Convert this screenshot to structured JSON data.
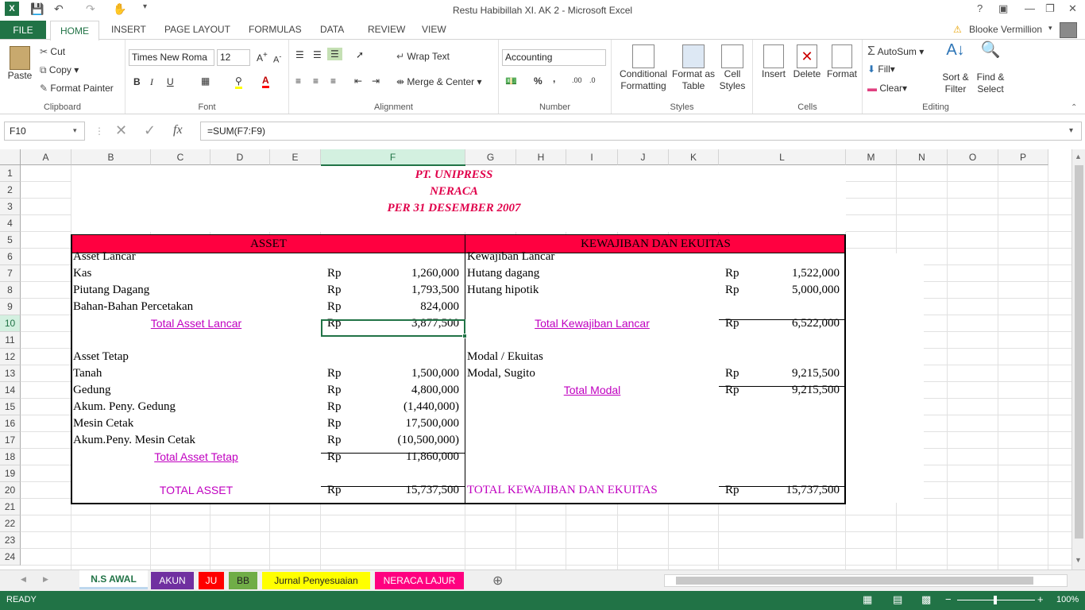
{
  "window": {
    "title": "Restu Habibillah XI. AK 2 - Microsoft Excel",
    "user": "Blooke Vermillion"
  },
  "ribbon_tabs": [
    "FILE",
    "HOME",
    "INSERT",
    "PAGE LAYOUT",
    "FORMULAS",
    "DATA",
    "REVIEW",
    "VIEW"
  ],
  "clipboard": {
    "paste": "Paste",
    "cut": "Cut",
    "copy": "Copy",
    "format_painter": "Format Painter",
    "label": "Clipboard"
  },
  "font": {
    "name": "Times New Roma",
    "size": "12",
    "bold": "B",
    "italic": "I",
    "underline": "U",
    "label": "Font"
  },
  "alignment": {
    "wrap": "Wrap Text",
    "merge": "Merge & Center",
    "label": "Alignment"
  },
  "number": {
    "format": "Accounting",
    "percent": "%",
    "comma": ",",
    "label": "Number"
  },
  "styles": {
    "conditional": [
      "Conditional",
      "Formatting"
    ],
    "format_table": [
      "Format as",
      "Table"
    ],
    "cell_styles": [
      "Cell",
      "Styles"
    ],
    "label": "Styles"
  },
  "cells": {
    "insert": "Insert",
    "delete": "Delete",
    "format": "Format",
    "label": "Cells"
  },
  "editing": {
    "autosum": "AutoSum",
    "fill": "Fill",
    "clear": "Clear",
    "sort": [
      "Sort &",
      "Filter"
    ],
    "find": [
      "Find &",
      "Select"
    ],
    "label": "Editing"
  },
  "formula_bar": {
    "name_box": "F10",
    "formula": "=SUM(F7:F9)",
    "fx": "fx"
  },
  "columns": [
    "A",
    "B",
    "C",
    "D",
    "E",
    "F",
    "G",
    "H",
    "I",
    "J",
    "K",
    "L",
    "M",
    "N",
    "O",
    "P"
  ],
  "rows": [
    "1",
    "2",
    "3",
    "4",
    "5",
    "6",
    "7",
    "8",
    "9",
    "10",
    "11",
    "12",
    "13",
    "14",
    "15",
    "16",
    "17",
    "18",
    "19",
    "20",
    "21",
    "22",
    "23",
    "24"
  ],
  "sheet": {
    "title1": "PT. UNIPRESS",
    "title2": "NERACA",
    "title3": "PER 31 DESEMBER 2007",
    "hdr_left": "ASSET",
    "hdr_right": "KEWAJIBAN DAN EKUITAS",
    "left": [
      {
        "row": 6,
        "label": "Asset Lancar",
        "rp": "",
        "val": ""
      },
      {
        "row": 7,
        "label": "Kas",
        "rp": "Rp",
        "val": "1,260,000"
      },
      {
        "row": 8,
        "label": "Piutang Dagang",
        "rp": "Rp",
        "val": "1,793,500"
      },
      {
        "row": 9,
        "label": "Bahan-Bahan Percetakan",
        "rp": "Rp",
        "val": "824,000"
      },
      {
        "row": 10,
        "label": "Total Asset Lancar",
        "rp": "Rp",
        "val": "3,877,500",
        "total": true
      },
      {
        "row": 12,
        "label": "Asset Tetap",
        "rp": "",
        "val": ""
      },
      {
        "row": 13,
        "label": "Tanah",
        "rp": "Rp",
        "val": "1,500,000"
      },
      {
        "row": 14,
        "label": "Gedung",
        "rp": "Rp",
        "val": "4,800,000"
      },
      {
        "row": 15,
        "label": "Akum. Peny. Gedung",
        "rp": "Rp",
        "val": "(1,440,000)"
      },
      {
        "row": 16,
        "label": "Mesin Cetak",
        "rp": "Rp",
        "val": "17,500,000"
      },
      {
        "row": 17,
        "label": "Akum.Peny. Mesin Cetak",
        "rp": "Rp",
        "val": "(10,500,000)"
      },
      {
        "row": 18,
        "label": "Total Asset Tetap",
        "rp": "Rp",
        "val": "11,860,000",
        "total": true
      },
      {
        "row": 20,
        "label": "TOTAL ASSET",
        "rp": "Rp",
        "val": "15,737,500",
        "grand": true
      }
    ],
    "right": [
      {
        "row": 6,
        "label": "Kewajiban Lancar",
        "rp": "",
        "val": ""
      },
      {
        "row": 7,
        "label": "Hutang dagang",
        "rp": "Rp",
        "val": "1,522,000"
      },
      {
        "row": 8,
        "label": "Hutang hipotik",
        "rp": "Rp",
        "val": "5,000,000"
      },
      {
        "row": 10,
        "label": "Total Kewajiban Lancar",
        "rp": "Rp",
        "val": "6,522,000",
        "total": true
      },
      {
        "row": 12,
        "label": "Modal / Ekuitas",
        "rp": "",
        "val": ""
      },
      {
        "row": 13,
        "label": "Modal, Sugito",
        "rp": "Rp",
        "val": "9,215,500"
      },
      {
        "row": 14,
        "label": "Total Modal ",
        "rp": "Rp",
        "val": "9,215,500",
        "total": true
      },
      {
        "row": 20,
        "label": "TOTAL KEWAJIBAN DAN EKUITAS",
        "rp": "Rp",
        "val": "15,737,500",
        "grand": true
      }
    ]
  },
  "sheet_tabs": [
    {
      "name": "N.S AWAL",
      "color": "#bdd7ee",
      "active": true
    },
    {
      "name": "AKUN",
      "color": "#7030a0"
    },
    {
      "name": "JU",
      "color": "#ff0000"
    },
    {
      "name": "BB",
      "color": "#70ad47"
    },
    {
      "name": "Jurnal Penyesuaian",
      "color": "#ffff00"
    },
    {
      "name": "NERACA LAJUR",
      "color": "#ff0080"
    }
  ],
  "status": {
    "ready": "READY",
    "zoom": "100%"
  },
  "colors": {
    "accent": "#217346",
    "header_fill": "#ff0040",
    "pink_text": "#c000c0"
  }
}
